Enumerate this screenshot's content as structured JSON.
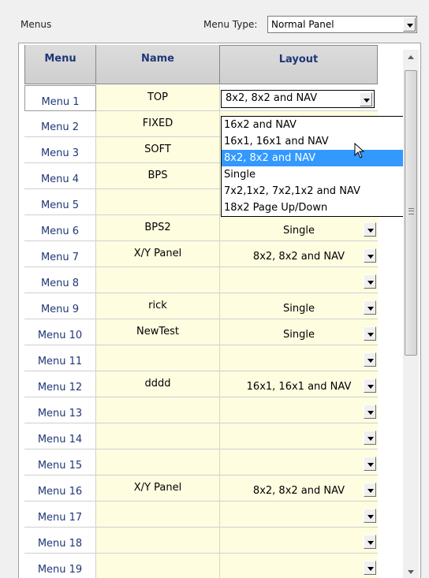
{
  "menus_label": "Menus",
  "menu_type": {
    "label": "Menu Type:",
    "value": "Normal Panel"
  },
  "grid": {
    "columns": [
      "Menu",
      "Name",
      "Layout"
    ],
    "rows": [
      {
        "menu": "Menu 1",
        "name": "TOP",
        "layout": "8x2, 8x2 and NAV"
      },
      {
        "menu": "Menu 2",
        "name": "FIXED",
        "layout": ""
      },
      {
        "menu": "Menu 3",
        "name": "SOFT",
        "layout": ""
      },
      {
        "menu": "Menu 4",
        "name": "BPS",
        "layout": ""
      },
      {
        "menu": "Menu 5",
        "name": "",
        "layout": ""
      },
      {
        "menu": "Menu 6",
        "name": "BPS2",
        "layout": "Single"
      },
      {
        "menu": "Menu 7",
        "name": "X/Y Panel",
        "layout": "8x2, 8x2 and NAV"
      },
      {
        "menu": "Menu 8",
        "name": "",
        "layout": ""
      },
      {
        "menu": "Menu 9",
        "name": "rick",
        "layout": "Single"
      },
      {
        "menu": "Menu 10",
        "name": "NewTest",
        "layout": "Single"
      },
      {
        "menu": "Menu 11",
        "name": "",
        "layout": ""
      },
      {
        "menu": "Menu 12",
        "name": "dddd",
        "layout": "16x1, 16x1 and NAV"
      },
      {
        "menu": "Menu 13",
        "name": "",
        "layout": ""
      },
      {
        "menu": "Menu 14",
        "name": "",
        "layout": ""
      },
      {
        "menu": "Menu 15",
        "name": "",
        "layout": ""
      },
      {
        "menu": "Menu 16",
        "name": "X/Y Panel",
        "layout": "8x2, 8x2 and NAV"
      },
      {
        "menu": "Menu 17",
        "name": "",
        "layout": ""
      },
      {
        "menu": "Menu 18",
        "name": "",
        "layout": ""
      },
      {
        "menu": "Menu 19",
        "name": "",
        "layout": ""
      }
    ]
  },
  "dropdown": {
    "options": [
      "16x2 and NAV",
      "16x1, 16x1 and NAV",
      "8x2, 8x2 and NAV",
      "Single",
      "7x2,1x2, 7x2,1x2 and NAV",
      "18x2 Page Up/Down"
    ],
    "highlighted": "8x2, 8x2 and NAV"
  },
  "colors": {
    "header_text": "#1f3778",
    "cell_bg": "#fffde0",
    "highlight": "#3399ff"
  },
  "icons": [
    "dropdown-arrow-icon",
    "mouse-pointer-icon",
    "scroll-up-icon",
    "scroll-down-icon"
  ]
}
